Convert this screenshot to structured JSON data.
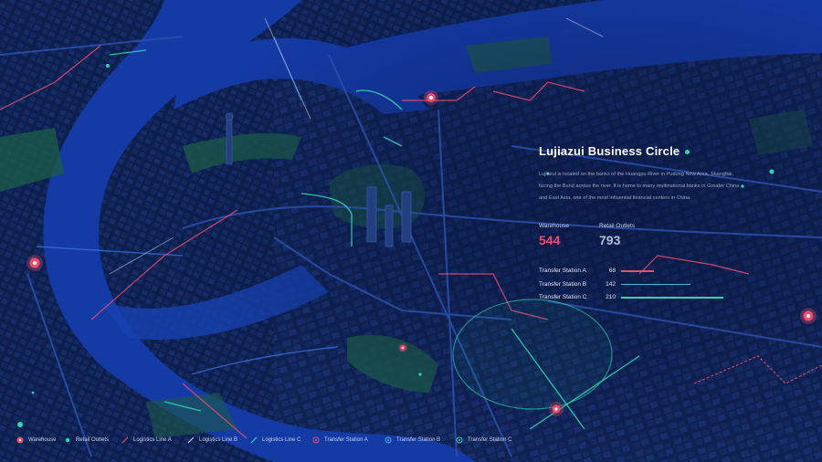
{
  "panel": {
    "title": "Lujiazui Business Circle",
    "description": "Lujiazui is located on the banks of the Huangpu River in Pudong New Area, Shanghai, facing the Bund across the river. It is home to many multinational banks in Greater China and East Asia, one of the most influential financial centers in China."
  },
  "stats": {
    "warehouse_label": "Warehouse",
    "warehouse_value": "544",
    "retail_label": "Retail Outlets",
    "retail_value": "793"
  },
  "stations": [
    {
      "name": "Transfer Station A",
      "value": "68",
      "fraction": 0.32,
      "color": "#ef4d6e"
    },
    {
      "name": "Transfer Station B",
      "value": "142",
      "fraction": 0.68,
      "color": "#4fb3d9"
    },
    {
      "name": "Transfer Station C",
      "value": "210",
      "fraction": 1.0,
      "color": "#34d3b2"
    }
  ],
  "legend": [
    {
      "label": "Warehouse",
      "icon": "warehouse-marker-icon",
      "color": "#ef4d6e"
    },
    {
      "label": "Retail Outlets",
      "icon": "retail-dot-icon",
      "color": "#34d3b2"
    },
    {
      "label": "Logistics Line A",
      "icon": "line-a-icon",
      "color": "#ef4d6e"
    },
    {
      "label": "Logistics Line B",
      "icon": "line-b-icon",
      "color": "#c8d2ee"
    },
    {
      "label": "Logistics Line C",
      "icon": "line-c-icon",
      "color": "#34d3b2"
    },
    {
      "label": "Transfer Station A",
      "icon": "station-a-icon",
      "color": "#ef4d6e"
    },
    {
      "label": "Transfer Station B",
      "icon": "station-b-icon",
      "color": "#4fb3d9"
    },
    {
      "label": "Transfer Station C",
      "icon": "station-c-icon",
      "color": "#34d3b2"
    }
  ],
  "colors": {
    "river": "#143aa6",
    "land": "#0e2150",
    "park": "#1c5a4a",
    "accent_red": "#ef4d6e",
    "accent_teal": "#34d3b2"
  }
}
